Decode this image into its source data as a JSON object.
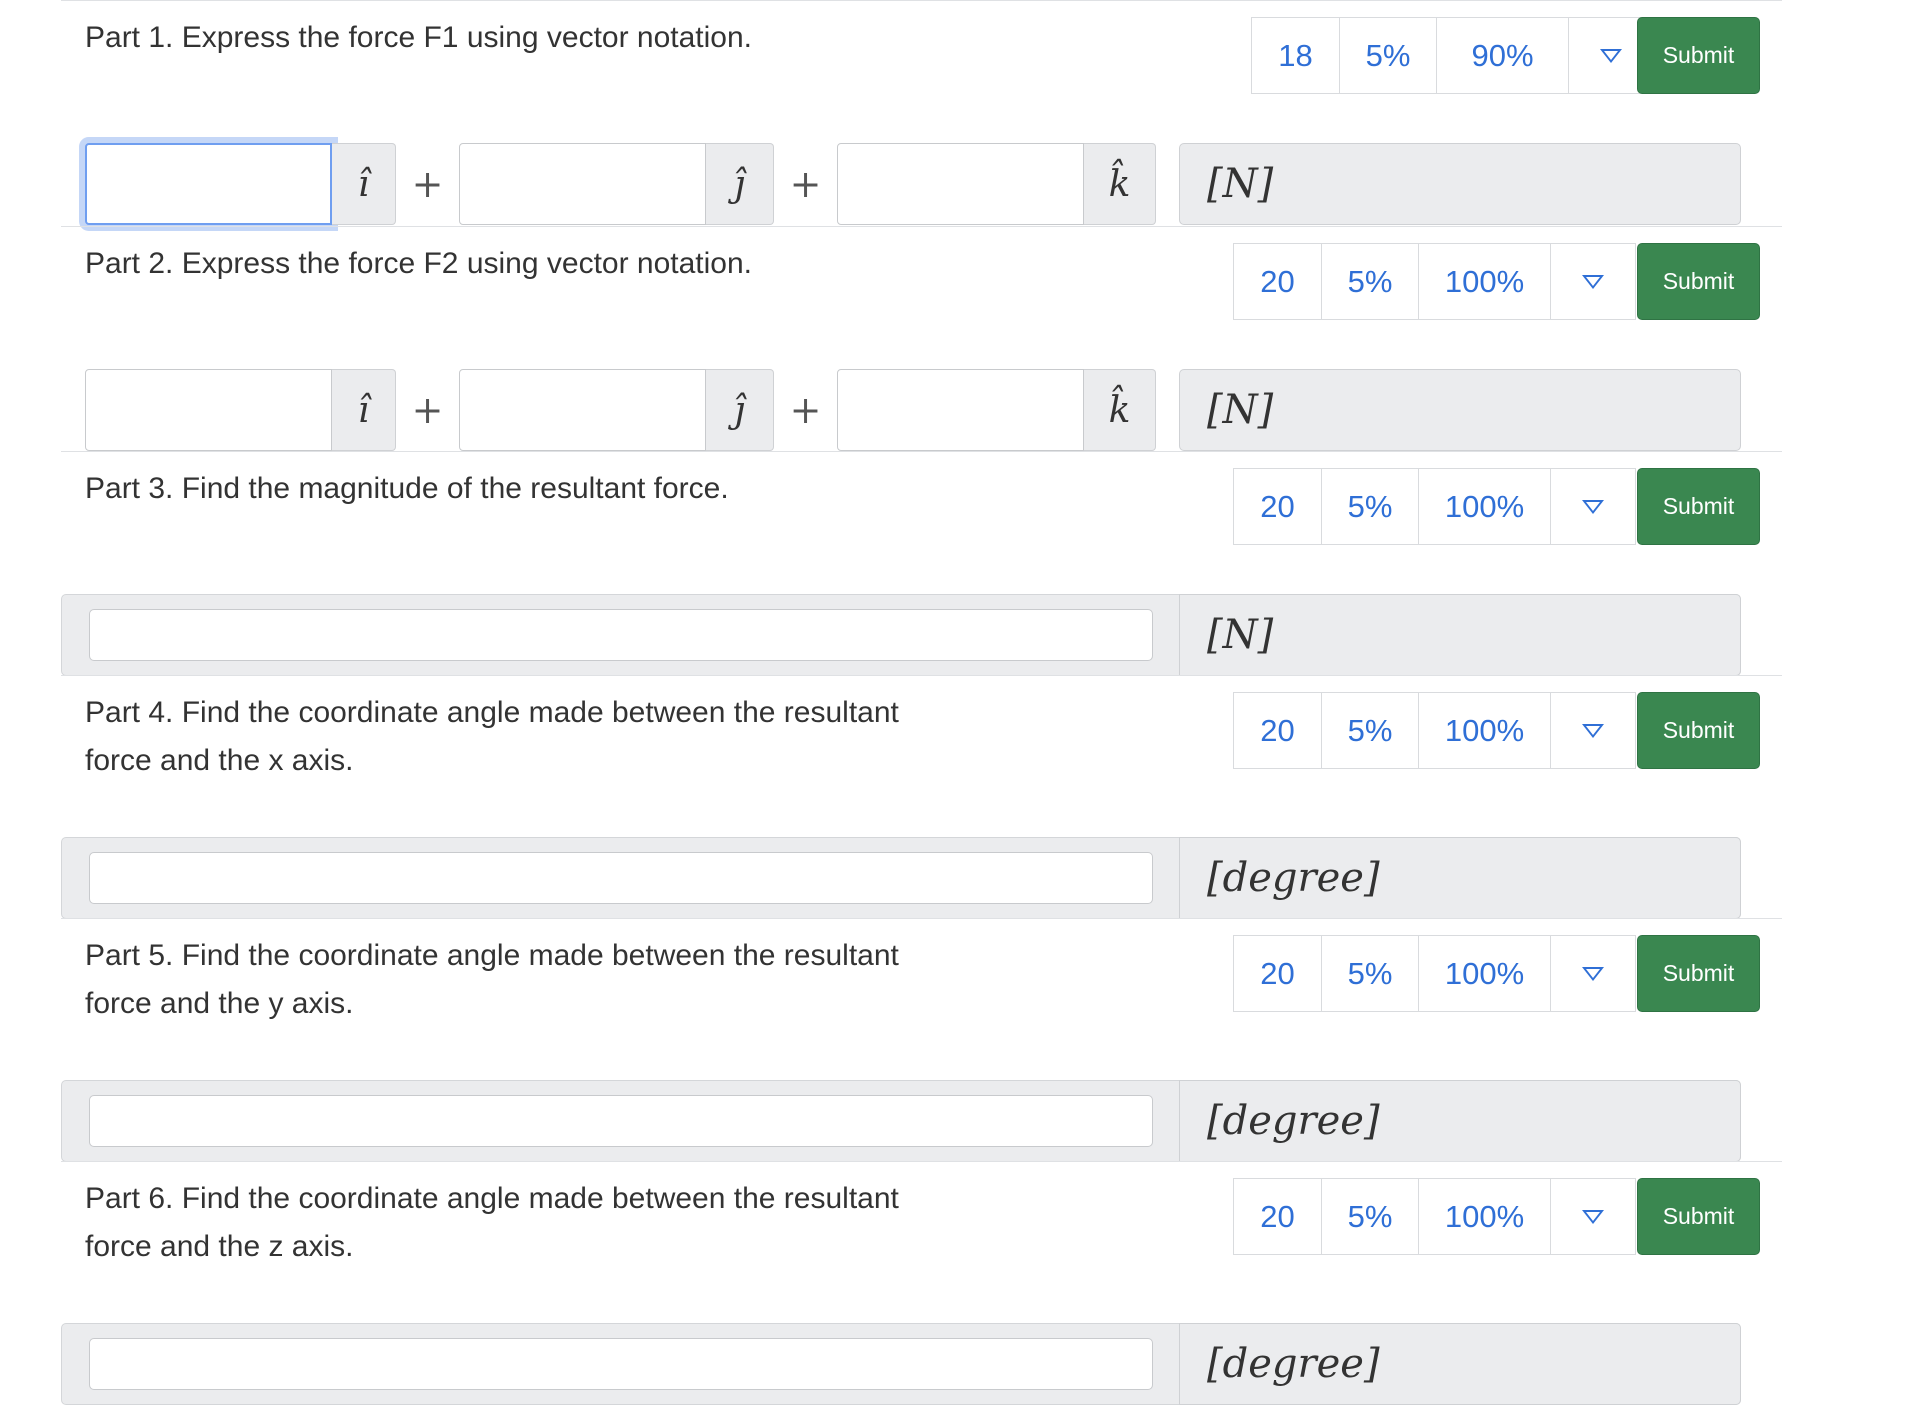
{
  "parts": [
    {
      "prompt": "Part 1. Express the force F1 using vector notation.",
      "attempts": "18",
      "deduction": "5%",
      "max": "90%",
      "submit": "Submit",
      "units": "[N]",
      "basis": [
        "î",
        "ĵ",
        "k̂"
      ],
      "plus": "+"
    },
    {
      "prompt": "Part 2. Express the force F2 using vector notation.",
      "attempts": "20",
      "deduction": "5%",
      "max": "100%",
      "submit": "Submit",
      "units": "[N]",
      "basis": [
        "î",
        "ĵ",
        "k̂"
      ],
      "plus": "+"
    },
    {
      "prompt": "Part 3. Find the magnitude of the resultant force.",
      "attempts": "20",
      "deduction": "5%",
      "max": "100%",
      "submit": "Submit",
      "units": "[N]"
    },
    {
      "prompt": "Part 4. Find the coordinate angle made between the resultant force and the x axis.",
      "attempts": "20",
      "deduction": "5%",
      "max": "100%",
      "submit": "Submit",
      "units": "[degree]"
    },
    {
      "prompt": "Part 5. Find the coordinate angle made between the resultant force and the y axis.",
      "attempts": "20",
      "deduction": "5%",
      "max": "100%",
      "submit": "Submit",
      "units": "[degree]"
    },
    {
      "prompt": "Part 6. Find the coordinate angle made between the resultant force and the z axis.",
      "attempts": "20",
      "deduction": "5%",
      "max": "100%",
      "submit": "Submit",
      "units": "[degree]"
    }
  ],
  "colors": {
    "accent": "#2f6fd6",
    "submit": "#3a8750",
    "panel": "#ebecee"
  },
  "icons": {
    "menu": "triangle-down-icon"
  }
}
